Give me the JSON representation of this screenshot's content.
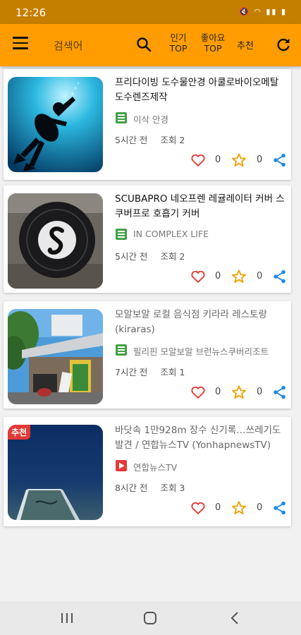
{
  "status": {
    "time": "12:26",
    "icons": "mute wifi lte battery"
  },
  "toolbar": {
    "menu_icon": "hamburger-menu-icon",
    "search_placeholder": "검색어",
    "search_icon": "search-icon",
    "tab_popular_line1": "인기",
    "tab_popular_line2": "TOP",
    "tab_likes_line1": "좋아요",
    "tab_likes_line2": "TOP",
    "tab_recommend": "추천",
    "refresh_icon": "refresh-icon",
    "color": "#ff9d00"
  },
  "posts": [
    {
      "title": "프리다이빙 도수물안경 아쿨로바이오메탈 도수렌즈제작",
      "source": "이삭 안경",
      "source_type": "blog",
      "time": "5시간 전",
      "views": "조회 2",
      "likes": "0",
      "stars": "0",
      "badge": ""
    },
    {
      "title": "SCUBAPRO 네오프렌 레귤레이터 커버 스쿠버프로 호흡기 커버",
      "source": "IN COMPLEX LIFE",
      "source_type": "blog",
      "time": "5시간 전",
      "views": "조회 2",
      "likes": "0",
      "stars": "0",
      "badge": ""
    },
    {
      "title": "모알보알 로컬 음식점 키라라 레스토랑 (kiraras)",
      "source": "필리핀 모알보알 브런뉴스쿠버리조트",
      "source_type": "blog",
      "time": "7시간 전",
      "views": "조회 1",
      "likes": "0",
      "stars": "0",
      "badge": ""
    },
    {
      "title": "바닷속 1만928m 장수 신기록…쓰레기도 발견 / 연합뉴스TV (YonhapnewsTV)",
      "source": "연합뉴스TV",
      "source_type": "video",
      "time": "8시간 전",
      "views": "조회 3",
      "likes": "0",
      "stars": "0",
      "badge": "추천"
    }
  ],
  "colors": {
    "heart": "#e53935",
    "star": "#f0a000",
    "share": "#1e88e5",
    "blog_icon": "#43a047",
    "video_icon": "#e53935"
  }
}
